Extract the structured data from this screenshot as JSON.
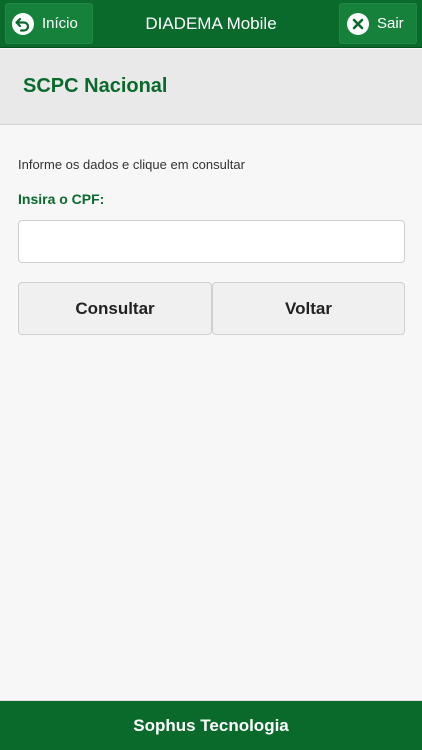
{
  "topbar": {
    "home_label": "Início",
    "title": "DIADEMA Mobile",
    "exit_label": "Sair",
    "home_icon": "back-arrow-icon",
    "exit_icon": "close-icon"
  },
  "page": {
    "title": "SCPC Nacional"
  },
  "form": {
    "instructions": "Informe os dados e clique em consultar",
    "cpf_label": "Insira o CPF:",
    "cpf_value": "",
    "cpf_placeholder": "",
    "submit_label": "Consultar",
    "back_label": "Voltar"
  },
  "footer": {
    "text": "Sophus Tecnologia"
  },
  "colors": {
    "brand_green": "#0a6a2c",
    "button_green": "#15813b",
    "header_gray": "#e9e9e9",
    "background": "#f7f7f7"
  }
}
